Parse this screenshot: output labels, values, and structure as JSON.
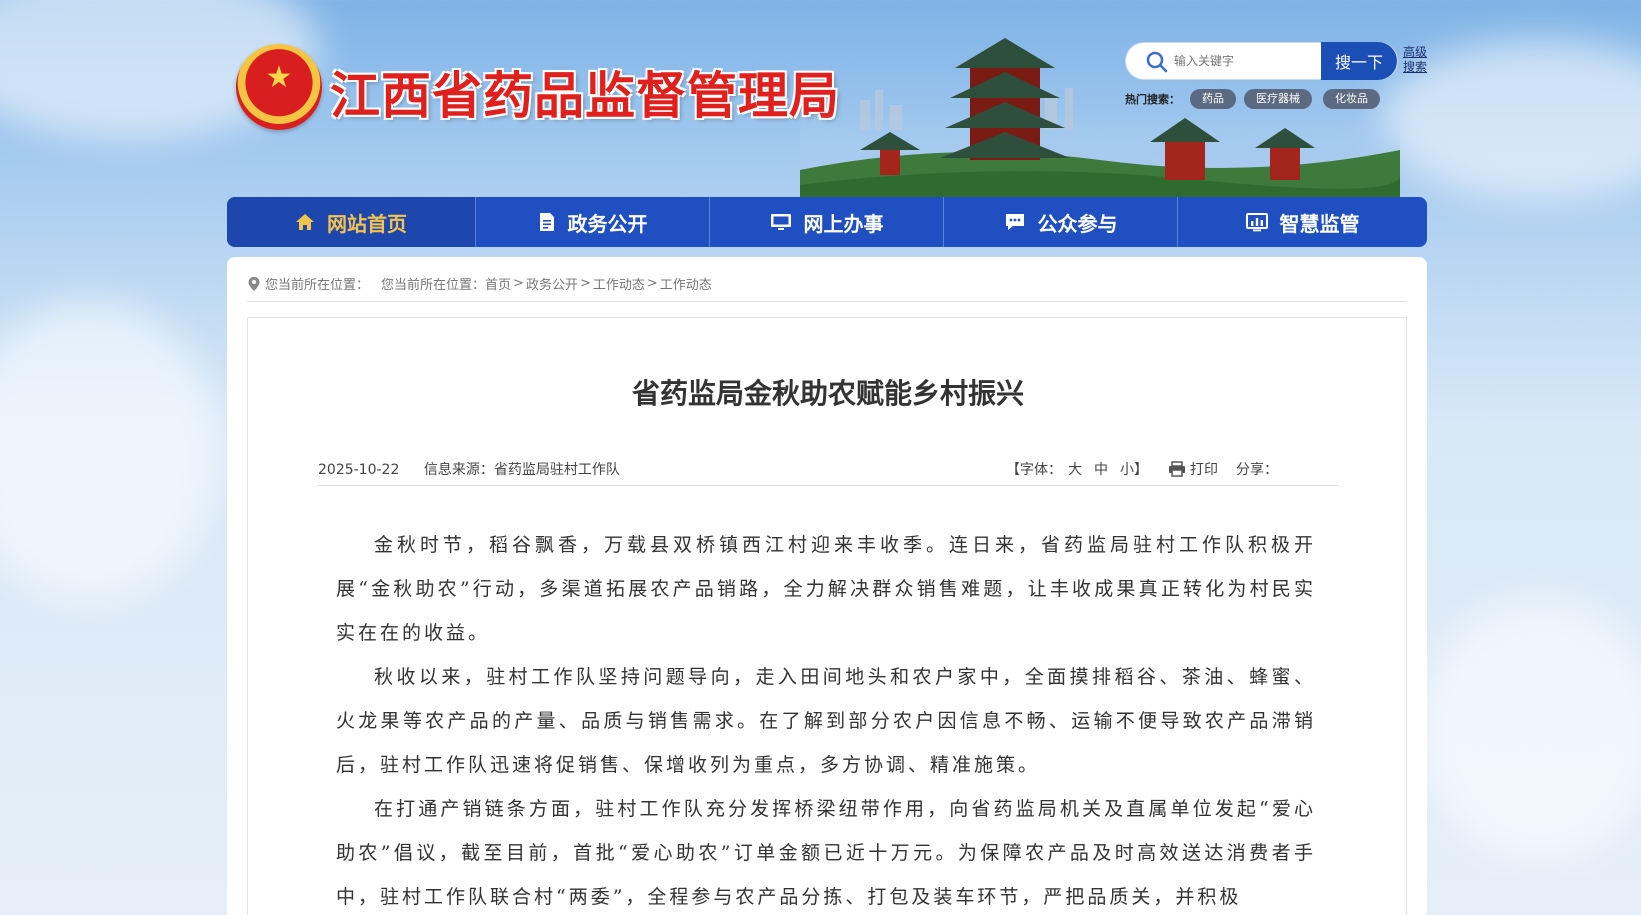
{
  "header": {
    "site_title": "江西省药品监督管理局",
    "search": {
      "placeholder": "输入关键字",
      "button_label": "搜一下",
      "advanced_label": "高级搜索"
    },
    "hot_search": {
      "label": "热门搜索：",
      "tags": [
        "药品",
        "医疗器械",
        "化妆品"
      ]
    }
  },
  "nav": {
    "items": [
      {
        "label": "网站首页",
        "icon": "home-icon"
      },
      {
        "label": "政务公开",
        "icon": "document-icon"
      },
      {
        "label": "网上办事",
        "icon": "monitor-icon"
      },
      {
        "label": "公众参与",
        "icon": "chat-icon"
      },
      {
        "label": "智慧监管",
        "icon": "dashboard-icon"
      }
    ],
    "active_index": 0
  },
  "breadcrumb": {
    "label": "您当前所在位置：",
    "label2": "您当前所在位置：",
    "items": [
      "首页",
      "政务公开",
      "工作动态",
      "工作动态"
    ],
    "separator": ">"
  },
  "article": {
    "title": "省药监局金秋助农赋能乡村振兴",
    "date": "2025-10-22",
    "source": "信息来源：省药监局驻村工作队",
    "font_label": "【字体：",
    "font_large": "大",
    "font_medium": "中",
    "font_small": "小】",
    "print_label": "打印",
    "share_label": "分享：",
    "paragraphs": [
      "金秋时节，稻谷飘香，万载县双桥镇西江村迎来丰收季。连日来，省药监局驻村工作队积极开展“金秋助农”行动，多渠道拓展农产品销路，全力解决群众销售难题，让丰收成果真正转化为村民实实在在的收益。",
      "秋收以来，驻村工作队坚持问题导向，走入田间地头和农户家中，全面摸排稻谷、茶油、蜂蜜、火龙果等农产品的产量、品质与销售需求。在了解到部分农户因信息不畅、运输不便导致农产品滞销后，驻村工作队迅速将促销售、保增收列为重点，多方协调、精准施策。",
      "在打通产销链条方面，驻村工作队充分发挥桥梁纽带作用，向省药监局机关及直属单位发起“爱心助农”倡议，截至目前，首批“爱心助农”订单金额已近十万元。为保障农产品及时高效送达消费者手中，驻村工作队联合村“两委”，全程参与农产品分拣、打包及装车环节，严把品质关，并积极"
    ]
  },
  "colors": {
    "nav_bg": "#1f4fc1",
    "nav_active_text": "#f3c34e",
    "title_red": "#e0201c",
    "search_button": "#1c4fb5"
  }
}
